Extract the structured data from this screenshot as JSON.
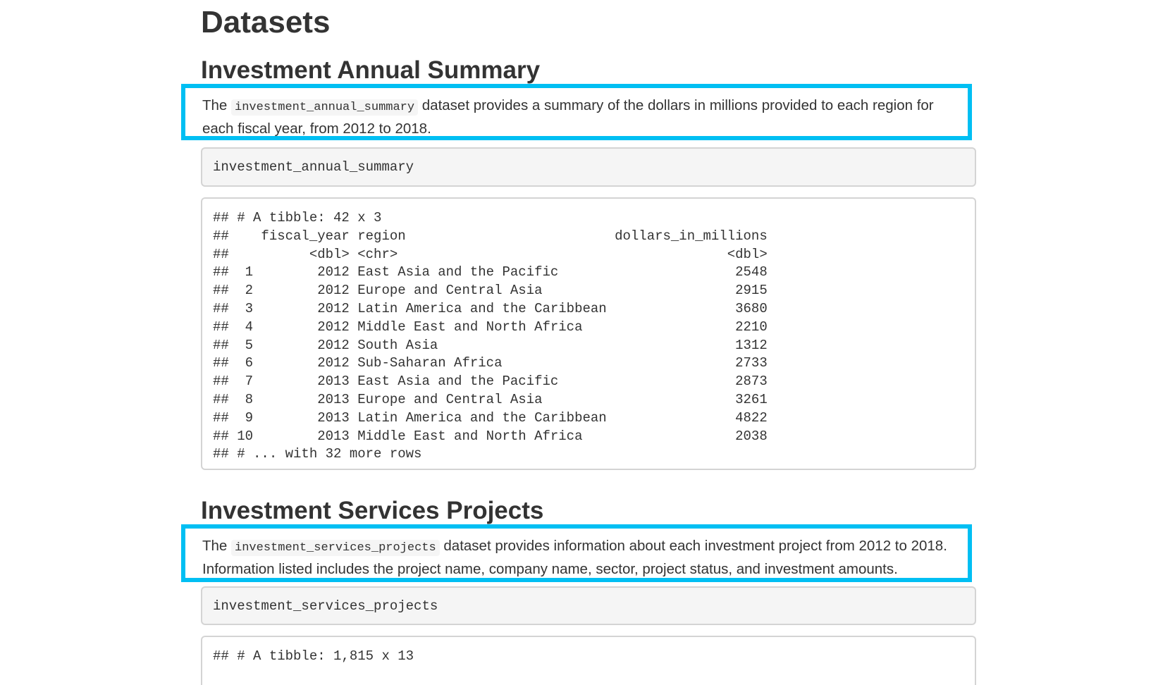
{
  "page": {
    "title": "Datasets"
  },
  "sections": [
    {
      "title": "Investment Annual Summary",
      "description": {
        "prefix": "The",
        "code": "investment_annual_summary",
        "suffix": "dataset provides a summary of the dollars in millions provided to each region for each fiscal year, from 2012 to 2018."
      },
      "code_input": "investment_annual_summary",
      "output_lines": [
        "## # A tibble: 42 x 3",
        "##    fiscal_year region                          dollars_in_millions",
        "##          <dbl> <chr>                                         <dbl>",
        "##  1        2012 East Asia and the Pacific                      2548",
        "##  2        2012 Europe and Central Asia                        2915",
        "##  3        2012 Latin America and the Caribbean                3680",
        "##  4        2012 Middle East and North Africa                   2210",
        "##  5        2012 South Asia                                     1312",
        "##  6        2012 Sub-Saharan Africa                             2733",
        "##  7        2013 East Asia and the Pacific                      2873",
        "##  8        2013 Europe and Central Asia                        3261",
        "##  9        2013 Latin America and the Caribbean                4822",
        "## 10        2013 Middle East and North Africa                   2038",
        "## # ... with 32 more rows"
      ]
    },
    {
      "title": "Investment Services Projects",
      "description": {
        "prefix": "The",
        "code": "investment_services_projects",
        "suffix": "dataset provides information about each investment project from 2012 to 2018. Information listed includes the project name, company name, sector, project status, and investment amounts."
      },
      "code_input": "investment_services_projects",
      "output_lines": [
        "## # A tibble: 1,815 x 13"
      ]
    }
  ],
  "colors": {
    "highlight_border": "#00bff3",
    "code_background": "#f5f5f5",
    "text": "#333333"
  }
}
